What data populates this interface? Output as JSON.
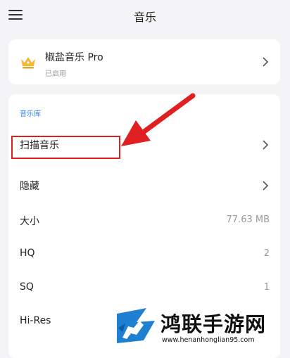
{
  "header": {
    "title": "音乐",
    "menu_icon": "hamburger-menu-icon"
  },
  "pro": {
    "name": "椒盐音乐 Pro",
    "status": "已启用",
    "icon": "crown-icon"
  },
  "library": {
    "section_title": "音乐库",
    "rows": [
      {
        "label": "扫描音乐",
        "value": "",
        "chevron": true
      },
      {
        "label": "隐藏",
        "value": "",
        "chevron": true
      },
      {
        "label": "大小",
        "value": "77.63 MB",
        "chevron": false
      },
      {
        "label": "HQ",
        "value": "2",
        "chevron": false
      },
      {
        "label": "SQ",
        "value": "1",
        "chevron": false
      },
      {
        "label": "Hi-Res",
        "value": "",
        "chevron": false
      }
    ]
  },
  "annotation": {
    "highlight_color": "#e02020",
    "arrow_color": "#e02020"
  },
  "watermark": {
    "title": "鸿联手游网",
    "url": "www.henanhonglian95.com"
  },
  "colors": {
    "accent": "#2f80ed",
    "background": "#f4f4f6",
    "crown": "#f0b93a"
  }
}
